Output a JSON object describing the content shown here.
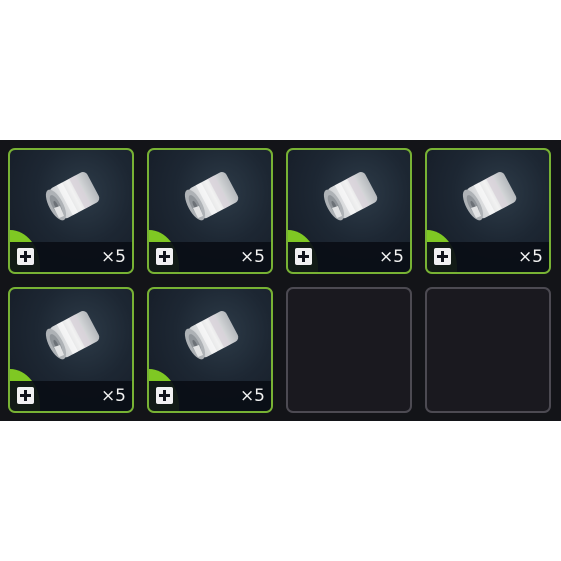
{
  "inventory": {
    "slots": [
      {
        "item": "bandage",
        "icon": "bandage-roll-icon",
        "quantity": "×5",
        "action_icon": "plus-icon",
        "rarity_color": "#7fc823"
      },
      {
        "item": "bandage",
        "icon": "bandage-roll-icon",
        "quantity": "×5",
        "action_icon": "plus-icon",
        "rarity_color": "#7fc823"
      },
      {
        "item": "bandage",
        "icon": "bandage-roll-icon",
        "quantity": "×5",
        "action_icon": "plus-icon",
        "rarity_color": "#7fc823"
      },
      {
        "item": "bandage",
        "icon": "bandage-roll-icon",
        "quantity": "×5",
        "action_icon": "plus-icon",
        "rarity_color": "#7fc823"
      },
      {
        "item": "bandage",
        "icon": "bandage-roll-icon",
        "quantity": "×5",
        "action_icon": "plus-icon",
        "rarity_color": "#7fc823"
      },
      {
        "item": "bandage",
        "icon": "bandage-roll-icon",
        "quantity": "×5",
        "action_icon": "plus-icon",
        "rarity_color": "#7fc823"
      },
      {
        "item": null
      },
      {
        "item": null
      }
    ]
  }
}
